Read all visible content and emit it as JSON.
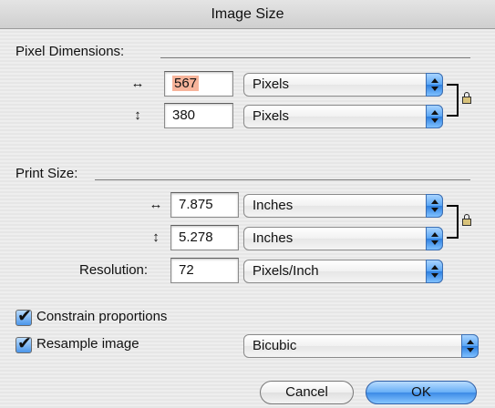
{
  "window": {
    "title": "Image Size"
  },
  "pixel_dimensions": {
    "heading": "Pixel Dimensions:",
    "width": {
      "value": "567",
      "unit": "Pixels"
    },
    "height": {
      "value": "380",
      "unit": "Pixels"
    }
  },
  "print_size": {
    "heading": "Print Size:",
    "width": {
      "value": "7.875",
      "unit": "Inches"
    },
    "height": {
      "value": "5.278",
      "unit": "Inches"
    },
    "resolution": {
      "label": "Resolution:",
      "value": "72",
      "unit": "Pixels/Inch"
    }
  },
  "options": {
    "constrain_label": "Constrain proportions",
    "constrain_checked": true,
    "resample_label": "Resample image",
    "resample_checked": true,
    "resample_method": "Bicubic"
  },
  "buttons": {
    "cancel": "Cancel",
    "ok": "OK"
  },
  "icons": {
    "width_arrow": "↔",
    "height_arrow": "↕"
  },
  "colors": {
    "accent": "#5aa6f5",
    "selection": "#f7b49b"
  }
}
